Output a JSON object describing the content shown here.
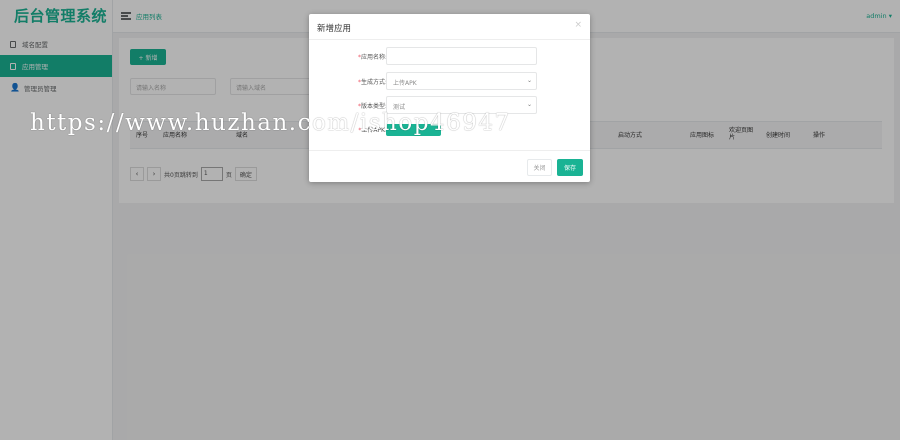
{
  "app_title": "后台管理系统",
  "sidebar": {
    "items": [
      {
        "label": "域名配置"
      },
      {
        "label": "应用管理"
      },
      {
        "label": "管理员管理"
      }
    ]
  },
  "topbar": {
    "breadcrumb": "应用列表",
    "user": "admin ▾"
  },
  "toolbar": {
    "add_label": "+ 新增"
  },
  "search": {
    "name_placeholder": "请输入名称",
    "domain_placeholder": "请输入域名"
  },
  "table": {
    "headers": [
      "序号",
      "应用名称",
      "域名",
      "启动方式",
      "应用图标",
      "欢迎页图片",
      "创建时间",
      "操作"
    ]
  },
  "pagination": {
    "prev": "‹",
    "next": "›",
    "total_text": "共0页跳转到",
    "page_value": "1",
    "page_unit": "页",
    "go_label": "确定"
  },
  "modal": {
    "title": "新增应用",
    "close_symbol": "×",
    "fields": {
      "name_label": "应用名称:",
      "mode_label": "生成方式:",
      "mode_value": "上传APK",
      "version_label": "版本类型:",
      "version_value": "测试",
      "upload_label": "上传APK:"
    },
    "close_button": "关闭",
    "save_button": "保存"
  },
  "watermark": "https://www.huzhan.com/ishop46947",
  "colors": {
    "accent": "#1ab394",
    "required": "#ed5565"
  }
}
